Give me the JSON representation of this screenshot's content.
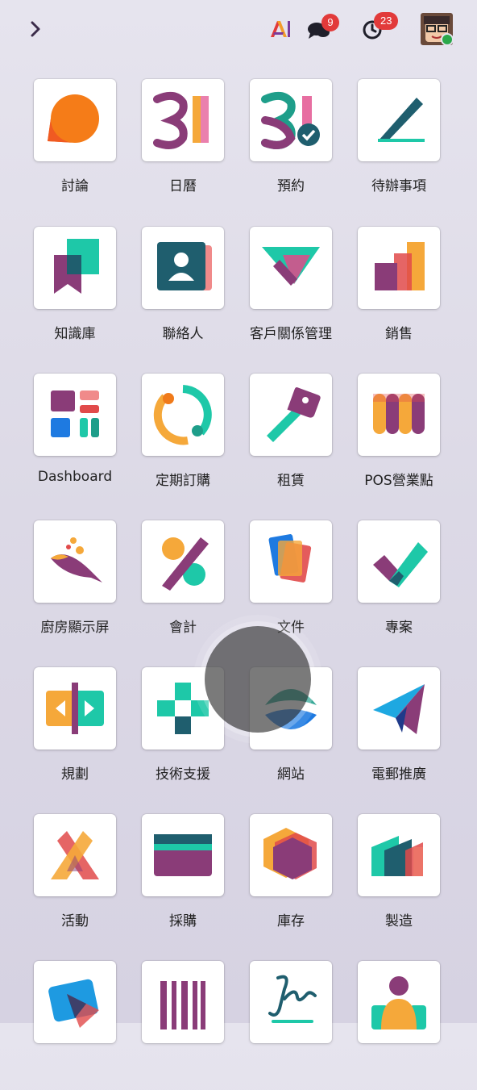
{
  "topbar": {
    "messages_count": "9",
    "activities_count": "23"
  },
  "apps": [
    {
      "label": "討論",
      "icon": "discuss-icon"
    },
    {
      "label": "日曆",
      "icon": "calendar-icon"
    },
    {
      "label": "預約",
      "icon": "appointment-icon"
    },
    {
      "label": "待辦事項",
      "icon": "todo-icon"
    },
    {
      "label": "知識庫",
      "icon": "knowledge-icon"
    },
    {
      "label": "聯絡人",
      "icon": "contacts-icon"
    },
    {
      "label": "客戶關係管理",
      "icon": "crm-icon"
    },
    {
      "label": "銷售",
      "icon": "sales-icon"
    },
    {
      "label": "Dashboard",
      "icon": "dashboard-icon"
    },
    {
      "label": "定期訂購",
      "icon": "subscriptions-icon"
    },
    {
      "label": "租賃",
      "icon": "rental-icon"
    },
    {
      "label": "POS營業點",
      "icon": "pos-icon"
    },
    {
      "label": "廚房顯示屏",
      "icon": "kitchen-display-icon"
    },
    {
      "label": "會計",
      "icon": "accounting-icon"
    },
    {
      "label": "文件",
      "icon": "documents-icon"
    },
    {
      "label": "專案",
      "icon": "project-icon"
    },
    {
      "label": "規劃",
      "icon": "planning-icon"
    },
    {
      "label": "技術支援",
      "icon": "helpdesk-icon"
    },
    {
      "label": "網站",
      "icon": "website-icon"
    },
    {
      "label": "電郵推廣",
      "icon": "email-marketing-icon"
    },
    {
      "label": "活動",
      "icon": "events-icon"
    },
    {
      "label": "採購",
      "icon": "purchase-icon"
    },
    {
      "label": "庫存",
      "icon": "inventory-icon"
    },
    {
      "label": "製造",
      "icon": "manufacturing-icon"
    },
    {
      "label": "",
      "icon": "app-icon-25"
    },
    {
      "label": "",
      "icon": "app-icon-26"
    },
    {
      "label": "",
      "icon": "sign-icon"
    },
    {
      "label": "",
      "icon": "employees-icon"
    }
  ]
}
